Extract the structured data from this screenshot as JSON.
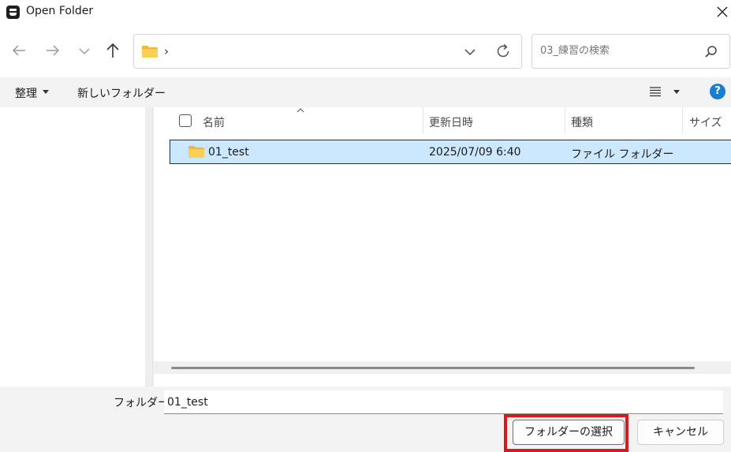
{
  "window": {
    "title": "Open Folder"
  },
  "nav": {
    "address_separator": "›"
  },
  "search": {
    "placeholder": "03_練習の検索"
  },
  "toolbar": {
    "organize_label": "整理",
    "new_folder_label": "新しいフォルダー"
  },
  "help": {
    "label": "?"
  },
  "columns": {
    "name": "名前",
    "date": "更新日時",
    "type": "種類",
    "size": "サイズ"
  },
  "files": [
    {
      "name": "01_test",
      "date": "2025/07/09 6:40",
      "type": "ファイル フォルダー"
    }
  ],
  "bottom": {
    "folder_label": "フォルダー:",
    "folder_value": "01_test",
    "select_label": "フォルダーの選択",
    "cancel_label": "キャンセル"
  },
  "colors": {
    "selection": "#cce8ff",
    "accent": "#1a7fd4",
    "highlight": "#e0161d",
    "folder": "#f7c548"
  }
}
